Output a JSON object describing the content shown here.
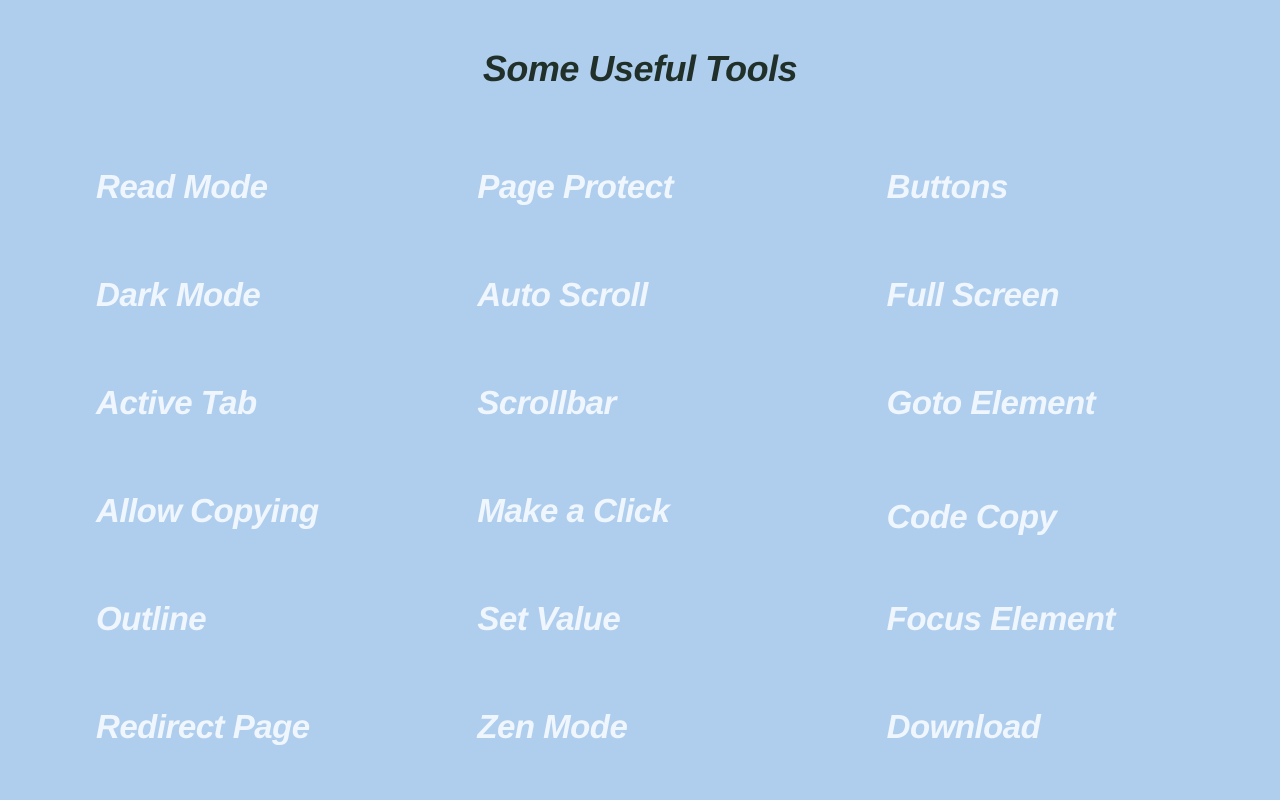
{
  "title": "Some Useful Tools",
  "columns": [
    [
      "Read Mode",
      "Dark Mode",
      "Active Tab",
      "Allow Copying",
      "Outline",
      "Redirect Page"
    ],
    [
      "Page Protect",
      "Auto Scroll",
      "Scrollbar",
      "Make a Click",
      "Set Value",
      "Zen Mode"
    ],
    [
      "Buttons",
      "Full Screen",
      "Goto Element",
      "Code Copy",
      "Focus Element",
      "Download"
    ]
  ]
}
